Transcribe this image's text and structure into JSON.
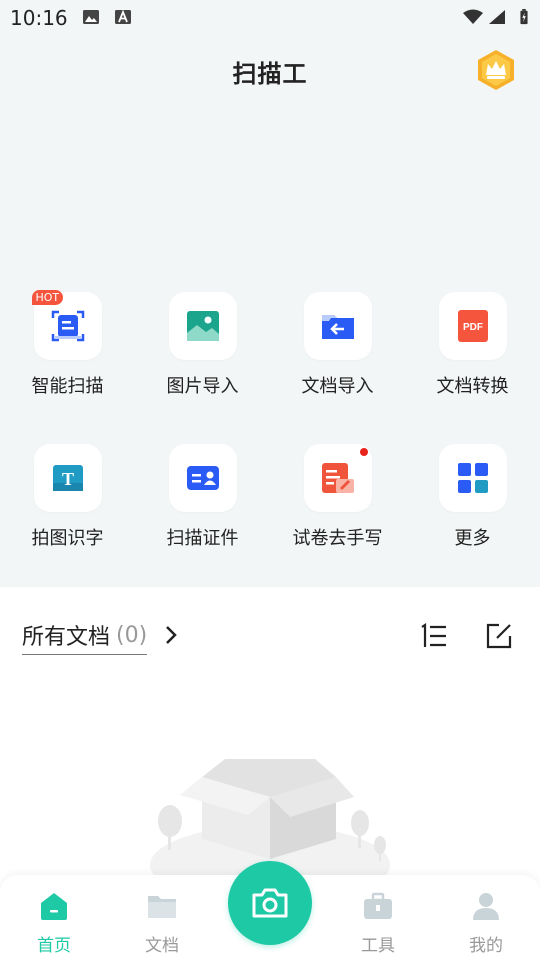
{
  "status_bar": {
    "time": "10:16"
  },
  "header": {
    "title": "扫描工"
  },
  "features": [
    {
      "label": "智能扫描",
      "badge": "HOT",
      "icon": "smart-scan-icon"
    },
    {
      "label": "图片导入",
      "icon": "image-import-icon"
    },
    {
      "label": "文档导入",
      "icon": "document-import-icon"
    },
    {
      "label": "文档转换",
      "icon": "pdf-convert-icon",
      "icon_text": "PDF"
    },
    {
      "label": "拍图识字",
      "icon": "text-recognition-icon",
      "icon_text": "T"
    },
    {
      "label": "扫描证件",
      "icon": "id-card-scan-icon"
    },
    {
      "label": "试卷去手写",
      "icon": "exam-remove-handwriting-icon",
      "has_dot": true
    },
    {
      "label": "更多",
      "icon": "more-grid-icon"
    }
  ],
  "documents": {
    "title": "所有文档",
    "count": "(0)"
  },
  "tabbar": {
    "tabs": [
      {
        "label": "首页",
        "active": true
      },
      {
        "label": "文档"
      },
      {
        "label": "工具"
      },
      {
        "label": "我的"
      }
    ]
  },
  "colors": {
    "accent": "#1ec9a5",
    "blue": "#2a5bf5",
    "red": "#f5553c",
    "teal_image": "#1aa58c"
  }
}
